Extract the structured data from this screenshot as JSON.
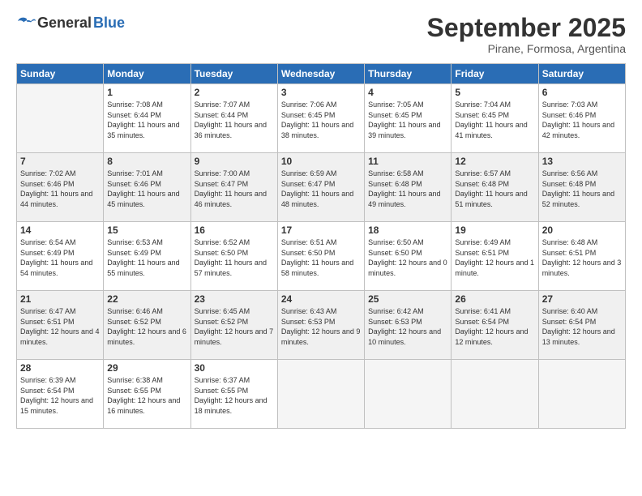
{
  "logo": {
    "general": "General",
    "blue": "Blue"
  },
  "title": "September 2025",
  "subtitle": "Pirane, Formosa, Argentina",
  "days_of_week": [
    "Sunday",
    "Monday",
    "Tuesday",
    "Wednesday",
    "Thursday",
    "Friday",
    "Saturday"
  ],
  "weeks": [
    [
      {
        "day": "",
        "empty": true
      },
      {
        "day": "1",
        "sunrise": "Sunrise: 7:08 AM",
        "sunset": "Sunset: 6:44 PM",
        "daylight": "Daylight: 11 hours and 35 minutes."
      },
      {
        "day": "2",
        "sunrise": "Sunrise: 7:07 AM",
        "sunset": "Sunset: 6:44 PM",
        "daylight": "Daylight: 11 hours and 36 minutes."
      },
      {
        "day": "3",
        "sunrise": "Sunrise: 7:06 AM",
        "sunset": "Sunset: 6:45 PM",
        "daylight": "Daylight: 11 hours and 38 minutes."
      },
      {
        "day": "4",
        "sunrise": "Sunrise: 7:05 AM",
        "sunset": "Sunset: 6:45 PM",
        "daylight": "Daylight: 11 hours and 39 minutes."
      },
      {
        "day": "5",
        "sunrise": "Sunrise: 7:04 AM",
        "sunset": "Sunset: 6:45 PM",
        "daylight": "Daylight: 11 hours and 41 minutes."
      },
      {
        "day": "6",
        "sunrise": "Sunrise: 7:03 AM",
        "sunset": "Sunset: 6:46 PM",
        "daylight": "Daylight: 11 hours and 42 minutes."
      }
    ],
    [
      {
        "day": "7",
        "sunrise": "Sunrise: 7:02 AM",
        "sunset": "Sunset: 6:46 PM",
        "daylight": "Daylight: 11 hours and 44 minutes."
      },
      {
        "day": "8",
        "sunrise": "Sunrise: 7:01 AM",
        "sunset": "Sunset: 6:46 PM",
        "daylight": "Daylight: 11 hours and 45 minutes."
      },
      {
        "day": "9",
        "sunrise": "Sunrise: 7:00 AM",
        "sunset": "Sunset: 6:47 PM",
        "daylight": "Daylight: 11 hours and 46 minutes."
      },
      {
        "day": "10",
        "sunrise": "Sunrise: 6:59 AM",
        "sunset": "Sunset: 6:47 PM",
        "daylight": "Daylight: 11 hours and 48 minutes."
      },
      {
        "day": "11",
        "sunrise": "Sunrise: 6:58 AM",
        "sunset": "Sunset: 6:48 PM",
        "daylight": "Daylight: 11 hours and 49 minutes."
      },
      {
        "day": "12",
        "sunrise": "Sunrise: 6:57 AM",
        "sunset": "Sunset: 6:48 PM",
        "daylight": "Daylight: 11 hours and 51 minutes."
      },
      {
        "day": "13",
        "sunrise": "Sunrise: 6:56 AM",
        "sunset": "Sunset: 6:48 PM",
        "daylight": "Daylight: 11 hours and 52 minutes."
      }
    ],
    [
      {
        "day": "14",
        "sunrise": "Sunrise: 6:54 AM",
        "sunset": "Sunset: 6:49 PM",
        "daylight": "Daylight: 11 hours and 54 minutes."
      },
      {
        "day": "15",
        "sunrise": "Sunrise: 6:53 AM",
        "sunset": "Sunset: 6:49 PM",
        "daylight": "Daylight: 11 hours and 55 minutes."
      },
      {
        "day": "16",
        "sunrise": "Sunrise: 6:52 AM",
        "sunset": "Sunset: 6:50 PM",
        "daylight": "Daylight: 11 hours and 57 minutes."
      },
      {
        "day": "17",
        "sunrise": "Sunrise: 6:51 AM",
        "sunset": "Sunset: 6:50 PM",
        "daylight": "Daylight: 11 hours and 58 minutes."
      },
      {
        "day": "18",
        "sunrise": "Sunrise: 6:50 AM",
        "sunset": "Sunset: 6:50 PM",
        "daylight": "Daylight: 12 hours and 0 minutes."
      },
      {
        "day": "19",
        "sunrise": "Sunrise: 6:49 AM",
        "sunset": "Sunset: 6:51 PM",
        "daylight": "Daylight: 12 hours and 1 minute."
      },
      {
        "day": "20",
        "sunrise": "Sunrise: 6:48 AM",
        "sunset": "Sunset: 6:51 PM",
        "daylight": "Daylight: 12 hours and 3 minutes."
      }
    ],
    [
      {
        "day": "21",
        "sunrise": "Sunrise: 6:47 AM",
        "sunset": "Sunset: 6:51 PM",
        "daylight": "Daylight: 12 hours and 4 minutes."
      },
      {
        "day": "22",
        "sunrise": "Sunrise: 6:46 AM",
        "sunset": "Sunset: 6:52 PM",
        "daylight": "Daylight: 12 hours and 6 minutes."
      },
      {
        "day": "23",
        "sunrise": "Sunrise: 6:45 AM",
        "sunset": "Sunset: 6:52 PM",
        "daylight": "Daylight: 12 hours and 7 minutes."
      },
      {
        "day": "24",
        "sunrise": "Sunrise: 6:43 AM",
        "sunset": "Sunset: 6:53 PM",
        "daylight": "Daylight: 12 hours and 9 minutes."
      },
      {
        "day": "25",
        "sunrise": "Sunrise: 6:42 AM",
        "sunset": "Sunset: 6:53 PM",
        "daylight": "Daylight: 12 hours and 10 minutes."
      },
      {
        "day": "26",
        "sunrise": "Sunrise: 6:41 AM",
        "sunset": "Sunset: 6:54 PM",
        "daylight": "Daylight: 12 hours and 12 minutes."
      },
      {
        "day": "27",
        "sunrise": "Sunrise: 6:40 AM",
        "sunset": "Sunset: 6:54 PM",
        "daylight": "Daylight: 12 hours and 13 minutes."
      }
    ],
    [
      {
        "day": "28",
        "sunrise": "Sunrise: 6:39 AM",
        "sunset": "Sunset: 6:54 PM",
        "daylight": "Daylight: 12 hours and 15 minutes."
      },
      {
        "day": "29",
        "sunrise": "Sunrise: 6:38 AM",
        "sunset": "Sunset: 6:55 PM",
        "daylight": "Daylight: 12 hours and 16 minutes."
      },
      {
        "day": "30",
        "sunrise": "Sunrise: 6:37 AM",
        "sunset": "Sunset: 6:55 PM",
        "daylight": "Daylight: 12 hours and 18 minutes."
      },
      {
        "day": "",
        "empty": true
      },
      {
        "day": "",
        "empty": true
      },
      {
        "day": "",
        "empty": true
      },
      {
        "day": "",
        "empty": true
      }
    ]
  ]
}
